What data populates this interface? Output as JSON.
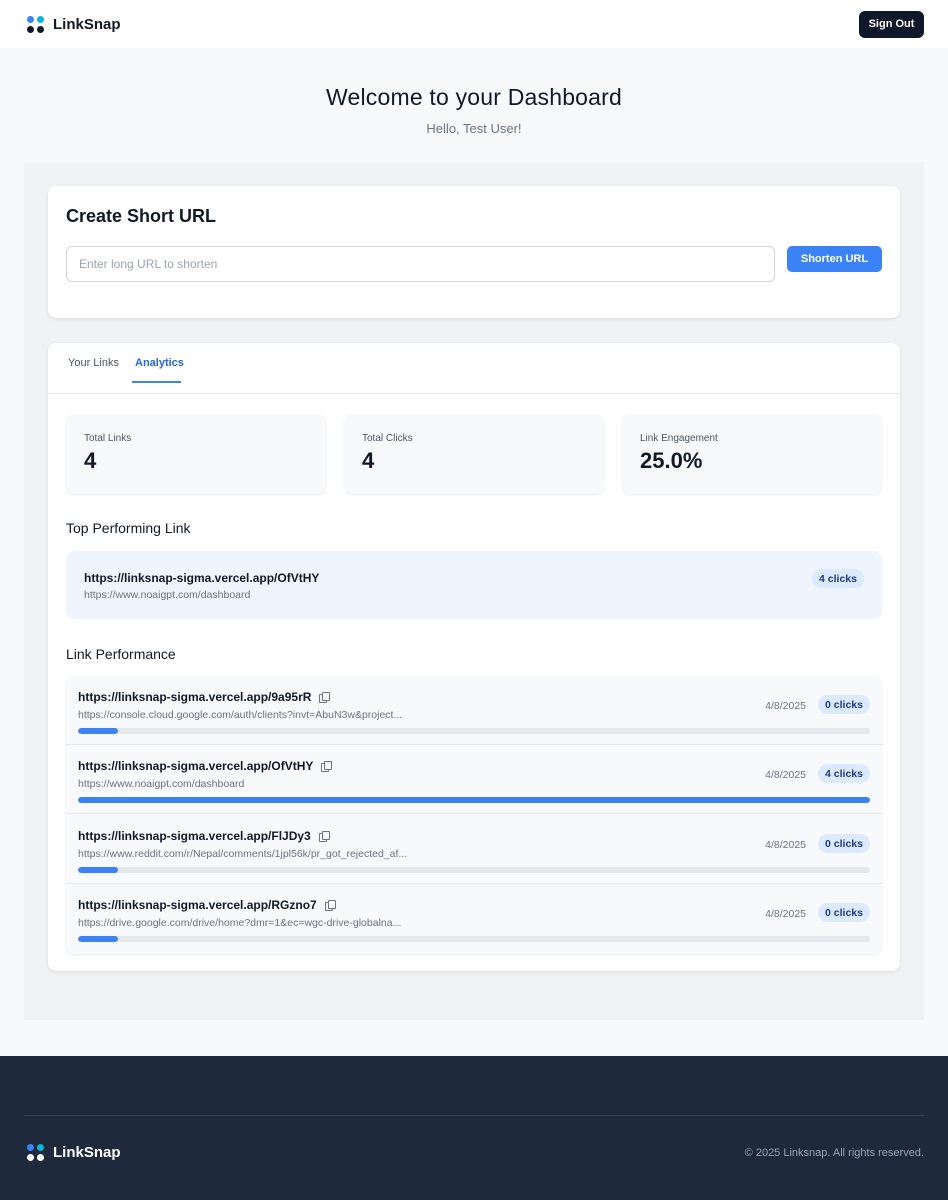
{
  "header": {
    "brand": "LinkSnap",
    "sign_out_label": "Sign Out"
  },
  "hero": {
    "title": "Welcome to your Dashboard",
    "greeting": "Hello, Test User!"
  },
  "create": {
    "title": "Create Short URL",
    "input_value": "",
    "input_placeholder": "Enter long URL to shorten",
    "button_label": "Shorten URL"
  },
  "tabs": [
    {
      "label": "Your Links",
      "active": false
    },
    {
      "label": "Analytics",
      "active": true
    }
  ],
  "stats": [
    {
      "label": "Total Links",
      "value": "4"
    },
    {
      "label": "Total Clicks",
      "value": "4"
    },
    {
      "label": "Link Engagement",
      "value": "25.0%"
    }
  ],
  "top_link": {
    "section_title": "Top Performing Link",
    "short_url": "https://linksnap-sigma.vercel.app/OfVtHY",
    "original_url": "https://www.noaigpt.com/dashboard",
    "clicks_label": "4 clicks"
  },
  "performance": {
    "section_title": "Link Performance",
    "rows": [
      {
        "short_url": "https://linksnap-sigma.vercel.app/9a95rR",
        "original_url": "https://console.cloud.google.com/auth/clients?invt=AbuN3w&project...",
        "date": "4/8/2025",
        "clicks_label": "0 clicks",
        "share": 0.05
      },
      {
        "short_url": "https://linksnap-sigma.vercel.app/OfVtHY",
        "original_url": "https://www.noaigpt.com/dashboard",
        "date": "4/8/2025",
        "clicks_label": "4 clicks",
        "share": 1.0
      },
      {
        "short_url": "https://linksnap-sigma.vercel.app/FlJDy3",
        "original_url": "https://www.reddit.com/r/Nepal/comments/1jpl56k/pr_got_rejected_af...",
        "date": "4/8/2025",
        "clicks_label": "0 clicks",
        "share": 0.05
      },
      {
        "short_url": "https://linksnap-sigma.vercel.app/RGzno7",
        "original_url": "https://drive.google.com/drive/home?dmr=1&ec=wgc-drive-globalna...",
        "date": "4/8/2025",
        "clicks_label": "0 clicks",
        "share": 0.05
      }
    ]
  },
  "footer": {
    "brand": "LinkSnap",
    "copyright": "© 2025 Linksnap. All rights reserved."
  },
  "colors": {
    "accent": "#3b82f6",
    "dark": "#0f172a",
    "footer_bg": "#1e293b"
  }
}
